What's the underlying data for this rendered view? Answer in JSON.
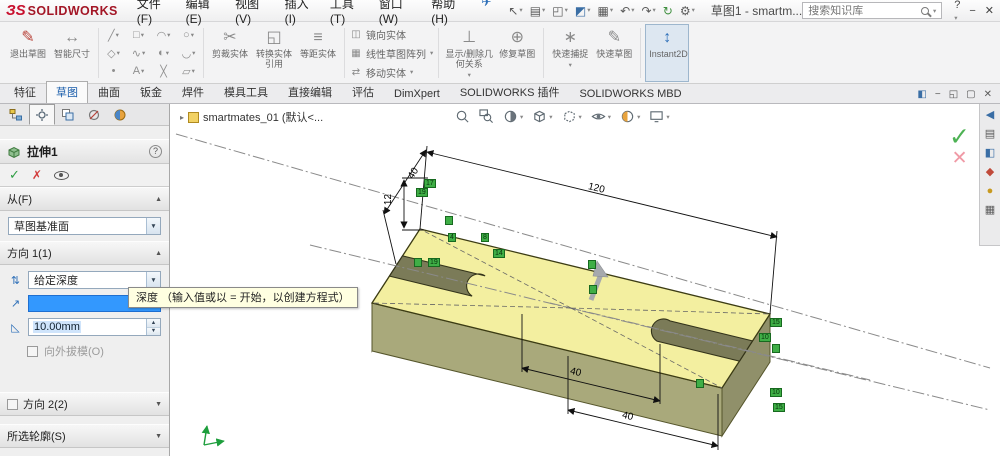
{
  "titlebar": {
    "logo_text": "SOLIDWORKS",
    "menus": [
      "文件(F)",
      "编辑(E)",
      "视图(V)",
      "插入(I)",
      "工具(T)",
      "窗口(W)",
      "帮助(H)"
    ],
    "doc_title": "草图1 - smartm...",
    "search_placeholder": "搜索知识库",
    "help_label": "?"
  },
  "ribbon": {
    "exit_sketch": "退出草图",
    "smart_dimension": "智能尺寸",
    "trim_entities": "剪裁实体",
    "convert_entities": "转换实体引用",
    "offset_entities": "等距实体",
    "mirror_entities": "镜向实体",
    "linear_pattern": "线性草图阵列",
    "move_entities": "移动实体",
    "display_delete_relations": "显示/删除几何关系",
    "repair_sketch": "修复草图",
    "quick_snaps": "快速捕捉",
    "rapid_sketch": "快速草图",
    "instant2d": "Instant2D"
  },
  "tabs": [
    "特征",
    "草图",
    "曲面",
    "钣金",
    "焊件",
    "模具工具",
    "直接编辑",
    "评估",
    "DimXpert",
    "SOLIDWORKS 插件",
    "SOLIDWORKS MBD"
  ],
  "panel": {
    "title": "拉伸1",
    "help_label": "?",
    "from_label": "从(F)",
    "from_value": "草图基准面",
    "direction1_label": "方向 1(1)",
    "end_condition": "给定深度",
    "depth_value": "10.00mm",
    "draft_outward": "向外拔模(O)",
    "direction2_label": "方向 2(2)",
    "contours_label": "所选轮廓(S)",
    "tooltip": "深度 （输入值或以 = 开始，以创建方程式）"
  },
  "viewport": {
    "tree_root": "smartmates_01 (默认<...",
    "dimensions": {
      "length": "120",
      "width": "40",
      "slot_offset": "12",
      "slot1": "40",
      "slot2": "40"
    },
    "markers": [
      "17",
      "19",
      "",
      "4",
      "8",
      "14",
      "19",
      "",
      "",
      "",
      "15",
      "10",
      "",
      "",
      "10",
      "15"
    ]
  }
}
